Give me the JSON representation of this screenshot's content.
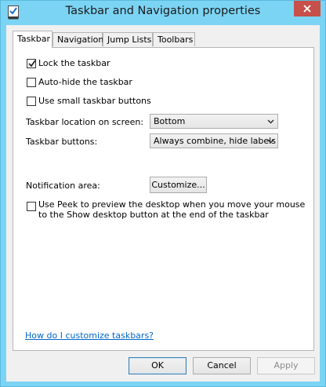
{
  "window": {
    "title": "Taskbar and Navigation properties",
    "accent_color": "#7cd4f4",
    "close_color": "#c7504a"
  },
  "tabs": [
    {
      "label": "Taskbar",
      "active": true
    },
    {
      "label": "Navigation",
      "active": false
    },
    {
      "label": "Jump Lists",
      "active": false
    },
    {
      "label": "Toolbars",
      "active": false
    }
  ],
  "checkboxes": {
    "lock": {
      "label": "Lock the taskbar",
      "checked": true
    },
    "autohide": {
      "label": "Auto-hide the taskbar",
      "checked": false
    },
    "small": {
      "label": "Use small taskbar buttons",
      "checked": false
    },
    "peek": {
      "label": "Use Peek to preview the desktop when you move your mouse to the Show desktop button at the end of the taskbar",
      "checked": false
    }
  },
  "settings": {
    "location": {
      "label": "Taskbar location on screen:",
      "value": "Bottom"
    },
    "buttons": {
      "label": "Taskbar buttons:",
      "value": "Always combine, hide labels"
    },
    "notification": {
      "label": "Notification area:",
      "button": "Customize..."
    }
  },
  "help_link": "How do I customize taskbars?",
  "footer": {
    "ok": "OK",
    "cancel": "Cancel",
    "apply": "Apply",
    "apply_disabled": true
  }
}
